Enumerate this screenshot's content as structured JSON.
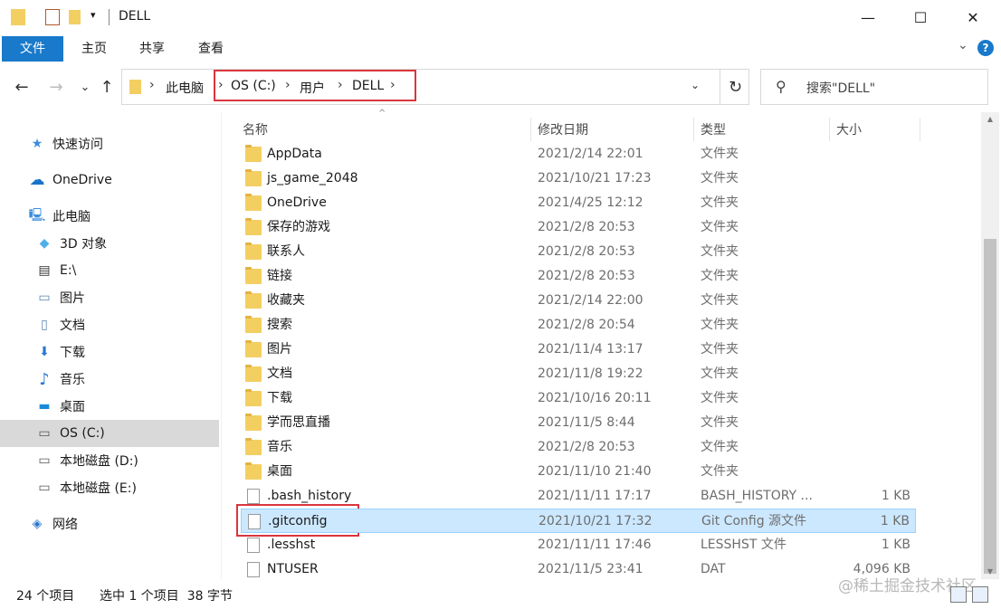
{
  "window": {
    "title": "DELL",
    "qa_dropdown_glyph": "▾",
    "minimize_glyph": "—",
    "maximize_glyph": "☐",
    "close_glyph": "✕"
  },
  "ribbon": {
    "tabs": [
      "文件",
      "主页",
      "共享",
      "查看"
    ],
    "expand_glyph": "⌄",
    "help_glyph": "?"
  },
  "address": {
    "back_glyph": "←",
    "forward_glyph": "→",
    "recent_glyph": "⌄",
    "up_glyph": "↑",
    "root": "此电脑",
    "crumbs": [
      "OS (C:)",
      "用户",
      "DELL"
    ],
    "sep": "›",
    "dropdown_glyph": "⌄",
    "refresh_glyph": "↻"
  },
  "search": {
    "placeholder": "搜索\"DELL\"",
    "icon_glyph": "⚲"
  },
  "sidebar": {
    "items": [
      {
        "label": "快速访问",
        "icon": "star-icon",
        "glyph": "★",
        "color": "#3a8dde"
      },
      {
        "label": "OneDrive",
        "icon": "cloud-icon",
        "glyph": "☁",
        "color": "#1a73c8"
      },
      {
        "label": "此电脑",
        "icon": "computer-icon",
        "glyph": "🖳",
        "color": "#3a8dde"
      },
      {
        "label": "3D 对象",
        "icon": "cube-icon",
        "glyph": "◆",
        "color": "#4fb0e8"
      },
      {
        "label": "E:\\",
        "icon": "drive-e-icon",
        "glyph": "▤",
        "color": "#333"
      },
      {
        "label": "图片",
        "icon": "pictures-icon",
        "glyph": "▭",
        "color": "#5a84b0"
      },
      {
        "label": "文档",
        "icon": "documents-icon",
        "glyph": "▯",
        "color": "#5a84b0"
      },
      {
        "label": "下载",
        "icon": "download-icon",
        "glyph": "⬇",
        "color": "#2a78d0"
      },
      {
        "label": "音乐",
        "icon": "music-icon",
        "glyph": "♪",
        "color": "#2a78d0"
      },
      {
        "label": "桌面",
        "icon": "desktop-icon",
        "glyph": "▬",
        "color": "#1a8ad8"
      },
      {
        "label": "OS (C:)",
        "icon": "drive-c-icon",
        "glyph": "▭",
        "color": "#555"
      },
      {
        "label": "本地磁盘 (D:)",
        "icon": "drive-d-icon",
        "glyph": "▭",
        "color": "#555"
      },
      {
        "label": "本地磁盘 (E:)",
        "icon": "drive-e2-icon",
        "glyph": "▭",
        "color": "#555"
      },
      {
        "label": "网络",
        "icon": "network-icon",
        "glyph": "◈",
        "color": "#2a78d0"
      }
    ]
  },
  "columns": {
    "name": "名称",
    "date": "修改日期",
    "type": "类型",
    "size": "大小",
    "sort_glyph": "^"
  },
  "files": [
    {
      "name": "AppData",
      "date": "2021/2/14 22:01",
      "type": "文件夹",
      "size": "",
      "kind": "folder"
    },
    {
      "name": "js_game_2048",
      "date": "2021/10/21 17:23",
      "type": "文件夹",
      "size": "",
      "kind": "folder"
    },
    {
      "name": "OneDrive",
      "date": "2021/4/25 12:12",
      "type": "文件夹",
      "size": "",
      "kind": "folder"
    },
    {
      "name": "保存的游戏",
      "date": "2021/2/8 20:53",
      "type": "文件夹",
      "size": "",
      "kind": "folder"
    },
    {
      "name": "联系人",
      "date": "2021/2/8 20:53",
      "type": "文件夹",
      "size": "",
      "kind": "folder"
    },
    {
      "name": "链接",
      "date": "2021/2/8 20:53",
      "type": "文件夹",
      "size": "",
      "kind": "folder"
    },
    {
      "name": "收藏夹",
      "date": "2021/2/14 22:00",
      "type": "文件夹",
      "size": "",
      "kind": "folder"
    },
    {
      "name": "搜索",
      "date": "2021/2/8 20:54",
      "type": "文件夹",
      "size": "",
      "kind": "folder"
    },
    {
      "name": "图片",
      "date": "2021/11/4 13:17",
      "type": "文件夹",
      "size": "",
      "kind": "folder"
    },
    {
      "name": "文档",
      "date": "2021/11/8 19:22",
      "type": "文件夹",
      "size": "",
      "kind": "folder"
    },
    {
      "name": "下载",
      "date": "2021/10/16 20:11",
      "type": "文件夹",
      "size": "",
      "kind": "folder"
    },
    {
      "name": "学而思直播",
      "date": "2021/11/5 8:44",
      "type": "文件夹",
      "size": "",
      "kind": "folder"
    },
    {
      "name": "音乐",
      "date": "2021/2/8 20:53",
      "type": "文件夹",
      "size": "",
      "kind": "folder"
    },
    {
      "name": "桌面",
      "date": "2021/11/10 21:40",
      "type": "文件夹",
      "size": "",
      "kind": "folder"
    },
    {
      "name": ".bash_history",
      "date": "2021/11/11 17:17",
      "type": "BASH_HISTORY ...",
      "size": "1 KB",
      "kind": "file"
    },
    {
      "name": ".gitconfig",
      "date": "2021/10/21 17:32",
      "type": "Git Config 源文件",
      "size": "1 KB",
      "kind": "file"
    },
    {
      "name": ".lesshst",
      "date": "2021/11/11 17:46",
      "type": "LESSHST 文件",
      "size": "1 KB",
      "kind": "file"
    },
    {
      "name": "NTUSER",
      "date": "2021/11/5 23:41",
      "type": "DAT",
      "size": "4,096 KB",
      "kind": "file"
    }
  ],
  "selected_index": 15,
  "status": {
    "count": "24 个项目",
    "selection": "选中 1 个项目  38 字节"
  },
  "watermark": "@稀土掘金技术社区",
  "colors": {
    "accent": "#1979ca",
    "selection_bg": "#cce8ff",
    "highlight_box": "#d9363e"
  }
}
